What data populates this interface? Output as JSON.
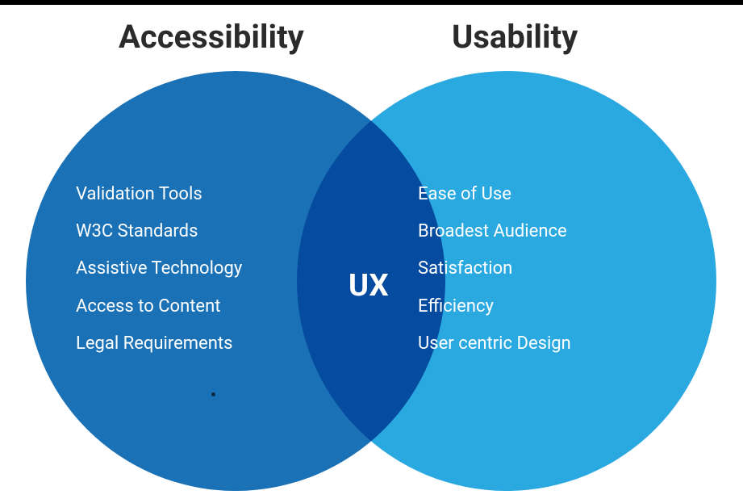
{
  "chart_data": {
    "type": "venn",
    "sets": [
      {
        "name": "Accessibility",
        "color": "#1a71b5",
        "items": [
          "Validation Tools",
          "W3C Standards",
          "Assistive Technology",
          "Access to Content",
          "Legal Requirements"
        ]
      },
      {
        "name": "Usability",
        "color": "#2aa9e0",
        "items": [
          "Ease of Use",
          "Broadest Audience",
          "Satisfaction",
          "Efficiency",
          "User centric Design"
        ]
      }
    ],
    "intersection": {
      "label": "UX"
    }
  }
}
